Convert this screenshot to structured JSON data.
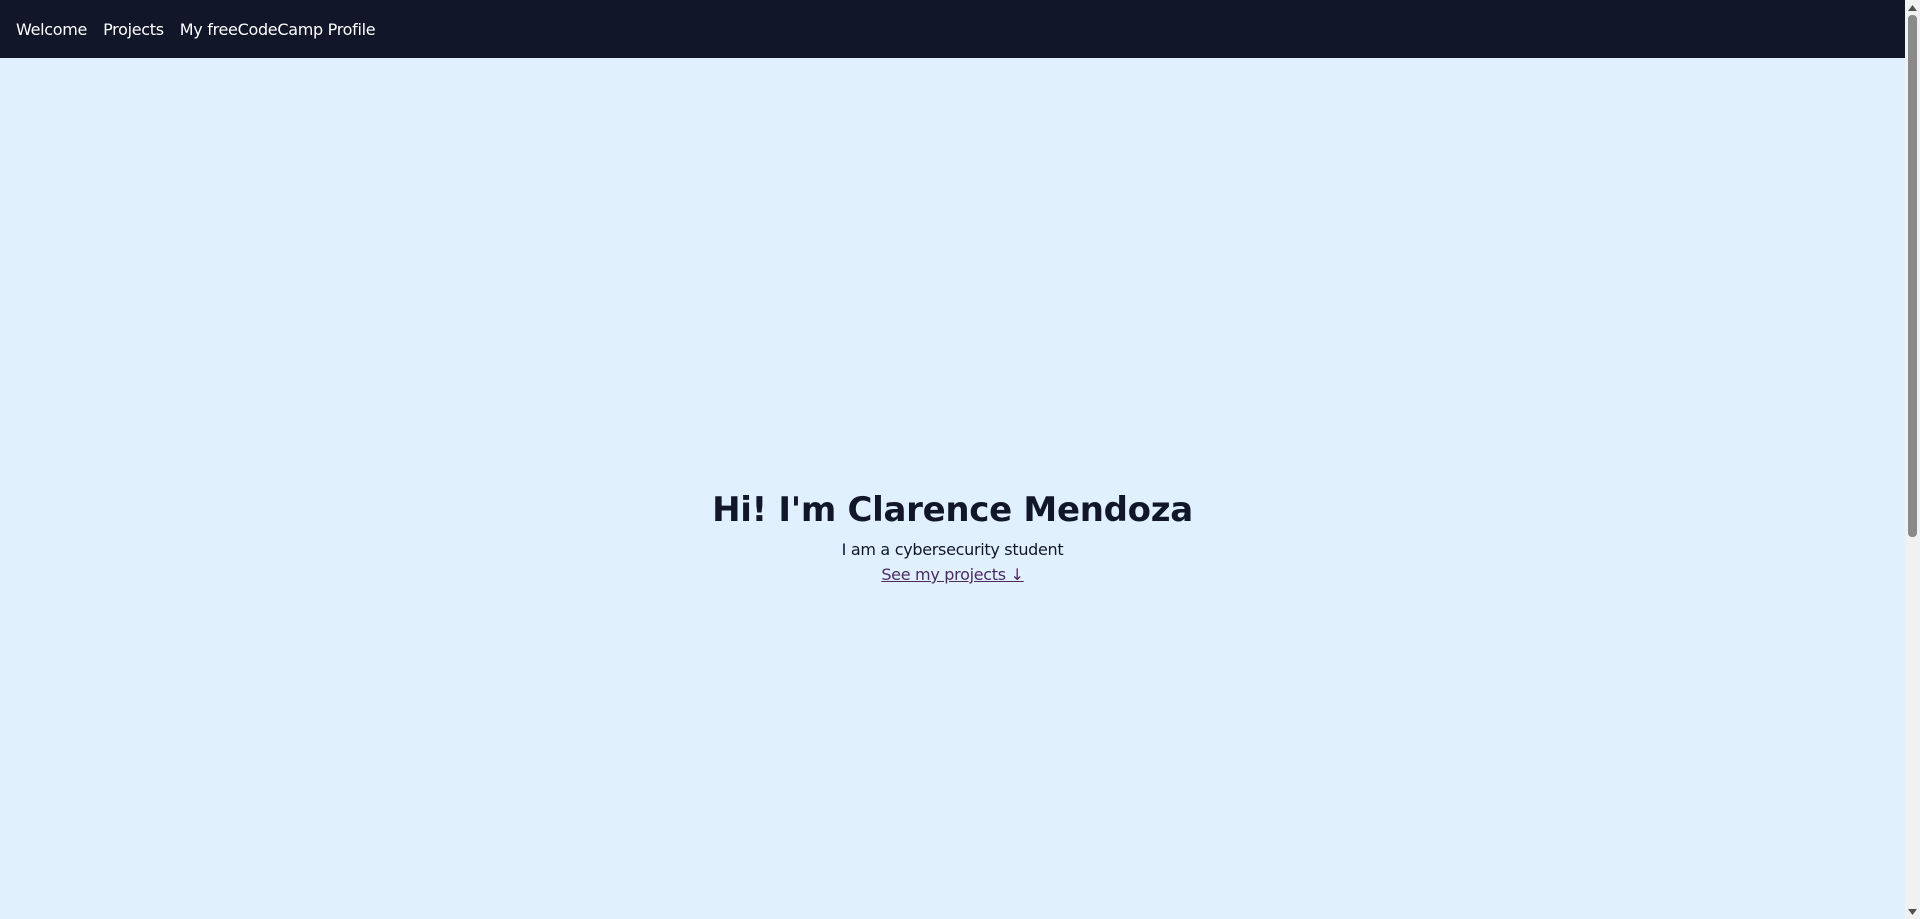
{
  "nav": {
    "items": [
      {
        "label": "Welcome"
      },
      {
        "label": "Projects"
      },
      {
        "label": "My freeCodeCamp Profile"
      }
    ]
  },
  "hero": {
    "title": "Hi! I'm Clarence Mendoza",
    "subtitle": "I am a cybersecurity student",
    "link_label": "See my projects ↓"
  },
  "colors": {
    "nav_bg": "#111629",
    "page_bg": "#e0f0fd",
    "text": "#111629",
    "link": "#4b2a63"
  },
  "icons": {
    "scroll_up": "triangle-up-icon",
    "scroll_down": "triangle-down-icon"
  }
}
